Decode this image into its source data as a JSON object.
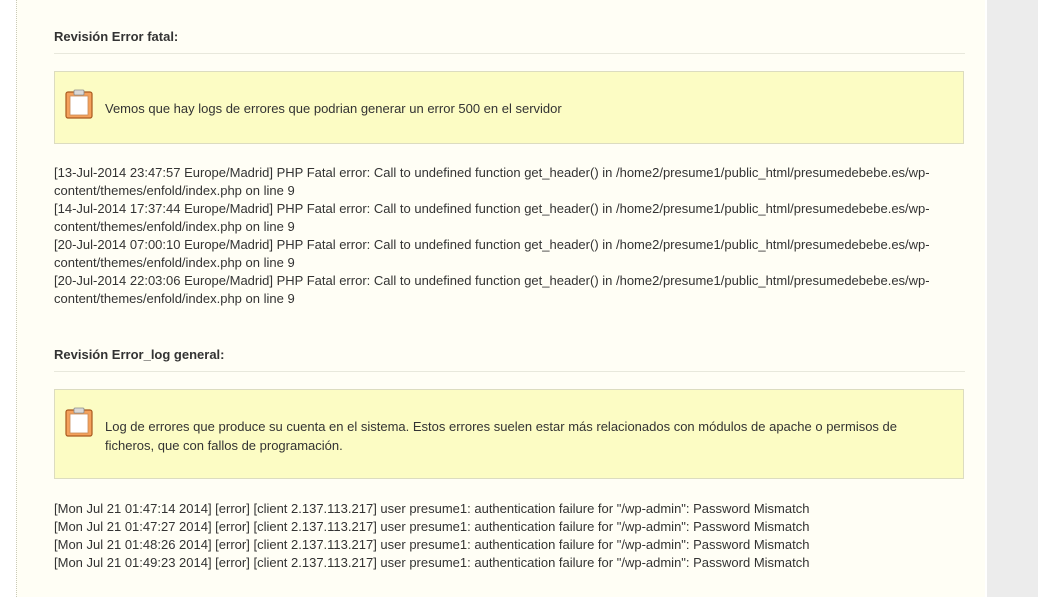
{
  "sections": [
    {
      "title": "Revisión Error fatal:",
      "notice": "Vemos que hay logs de errores que podrian generar un error 500 en el servidor",
      "log_lines": [
        "[13-Jul-2014 23:47:57 Europe/Madrid] PHP Fatal error: Call to undefined function get_header() in /home2/presume1/public_html/presumedebebe.es/wp-",
        "content/themes/enfold/index.php on line 9",
        "[14-Jul-2014 17:37:44 Europe/Madrid] PHP Fatal error: Call to undefined function get_header() in /home2/presume1/public_html/presumedebebe.es/wp-",
        "content/themes/enfold/index.php on line 9",
        "[20-Jul-2014 07:00:10 Europe/Madrid] PHP Fatal error: Call to undefined function get_header() in /home2/presume1/public_html/presumedebebe.es/wp-",
        "content/themes/enfold/index.php on line 9",
        "[20-Jul-2014 22:03:06 Europe/Madrid] PHP Fatal error: Call to undefined function get_header() in /home2/presume1/public_html/presumedebebe.es/wp-",
        "content/themes/enfold/index.php on line 9"
      ]
    },
    {
      "title": "Revisión Error_log general:",
      "notice_lines": [
        "Log de errores que produce su cuenta en el sistema. Estos errores suelen estar más relacionados con módulos de apache o permisos de",
        "ficheros, que con fallos de programación."
      ],
      "log_lines": [
        "[Mon Jul 21 01:47:14 2014] [error] [client 2.137.113.217] user presume1: authentication failure for \"/wp-admin\": Password Mismatch",
        "[Mon Jul 21 01:47:27 2014] [error] [client 2.137.113.217] user presume1: authentication failure for \"/wp-admin\": Password Mismatch",
        "[Mon Jul 21 01:48:26 2014] [error] [client 2.137.113.217] user presume1: authentication failure for \"/wp-admin\": Password Mismatch",
        "[Mon Jul 21 01:49:23 2014] [error] [client 2.137.113.217] user presume1: authentication failure for \"/wp-admin\": Password Mismatch"
      ]
    }
  ],
  "icons": {
    "notice_icon": "clipboard-icon"
  },
  "colors": {
    "notice_bg": "#fcfcc4",
    "panel_bg": "#fffef5",
    "icon_fill": "#f4a15c",
    "icon_border": "#a95a1e"
  }
}
